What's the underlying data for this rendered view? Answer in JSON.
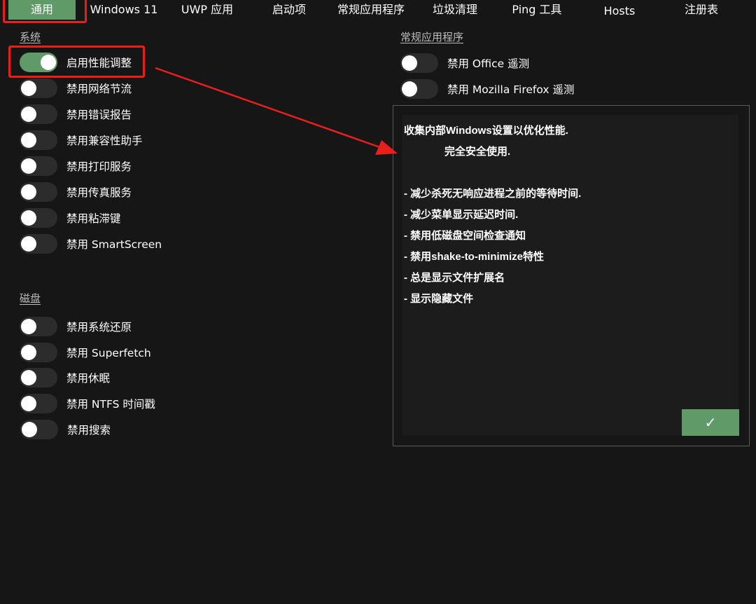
{
  "tabs": [
    {
      "label": "通用",
      "active": true
    },
    {
      "label": "Windows 11",
      "active": false
    },
    {
      "label": "UWP 应用",
      "active": false
    },
    {
      "label": "启动项",
      "active": false
    },
    {
      "label": "常规应用程序",
      "active": false
    },
    {
      "label": "垃圾清理",
      "active": false
    },
    {
      "label": "Ping 工具",
      "active": false
    },
    {
      "label": "Hosts",
      "active": false
    },
    {
      "label": "注册表",
      "active": false
    }
  ],
  "system": {
    "title": "系统",
    "toggles": [
      {
        "label": "启用性能调整",
        "on": true
      },
      {
        "label": "禁用网络节流",
        "on": false
      },
      {
        "label": "禁用错误报告",
        "on": false
      },
      {
        "label": "禁用兼容性助手",
        "on": false
      },
      {
        "label": "禁用打印服务",
        "on": false
      },
      {
        "label": "禁用传真服务",
        "on": false
      },
      {
        "label": "禁用粘滞键",
        "on": false
      },
      {
        "label": "禁用 SmartScreen",
        "on": false
      }
    ]
  },
  "disk": {
    "title": "磁盘",
    "toggles": [
      {
        "label": "禁用系统还原",
        "on": false
      },
      {
        "label": "禁用 Superfetch",
        "on": false
      },
      {
        "label": "禁用休眠",
        "on": false
      },
      {
        "label": "禁用 NTFS 时间戳",
        "on": false
      },
      {
        "label": "禁用搜索",
        "on": false
      }
    ]
  },
  "apps": {
    "title": "常规应用程序",
    "toggles": [
      {
        "label": "禁用 Office 遥测",
        "on": false
      },
      {
        "label": "禁用 Mozilla Firefox 遥测",
        "on": false
      }
    ]
  },
  "info_panel": {
    "lines": [
      "收集内部Windows设置以优化性能.",
      "完全安全使用.",
      "",
      "- 减少杀死无响应进程之前的等待时间.",
      "- 减少菜单显示延迟时间.",
      "- 禁用低磁盘空间检查通知",
      "- 禁用shake-to-minimize特性",
      "- 总是显示文件扩展名",
      "- 显示隐藏文件"
    ],
    "confirm_symbol": "✓"
  },
  "colors": {
    "background": "#161616",
    "accent": "#5f9a68",
    "annotation": "#e8201c"
  }
}
